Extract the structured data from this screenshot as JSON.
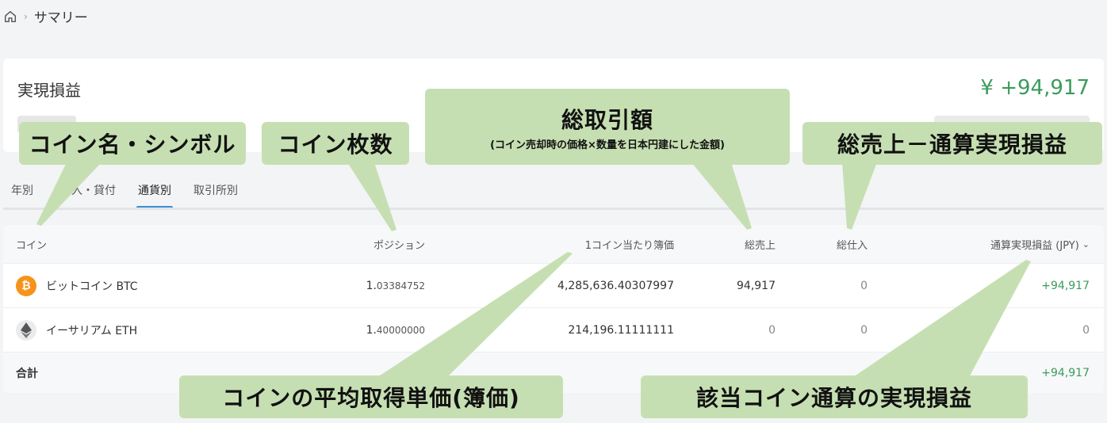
{
  "breadcrumb": {
    "current": "サマリー"
  },
  "summary": {
    "title": "実現損益",
    "value": "¥ +94,917"
  },
  "tabs": [
    {
      "label": "年別",
      "active": false
    },
    {
      "label": "入・貸付",
      "active": false
    },
    {
      "label": "通貨別",
      "active": true
    },
    {
      "label": "取引所別",
      "active": false
    }
  ],
  "table": {
    "headers": {
      "coin": "コイン",
      "position": "ポジション",
      "unit_price": "1コイン当たり簿価",
      "total_sales": "総売上",
      "total_purchase": "総仕入",
      "pnl": "通算実現損益 (JPY)"
    },
    "rows": [
      {
        "name": "ビットコイン BTC",
        "pos_main": "1.",
        "pos_dec": "03384752",
        "unit_price": "4,285,636.40307997",
        "sales": "94,917",
        "purchase": "0",
        "pnl": "+94,917"
      },
      {
        "name": "イーサリアム ETH",
        "pos_main": "1.",
        "pos_dec": "40000000",
        "unit_price": "214,196.11111111",
        "sales": "0",
        "purchase": "0",
        "pnl": "0"
      }
    ],
    "total": {
      "label": "合計",
      "pnl": "+94,917"
    }
  },
  "annotations": {
    "coin_name": "コイン名・シンボル",
    "coin_count": "コイン枚数",
    "total_trade": "総取引額",
    "total_trade_sub": "(コイン売却時の価格×数量を日本円建にした金額)",
    "sales_minus": "総売上－通算実現損益",
    "avg_price": "コインの平均取得単価(簿価)",
    "coin_pnl": "該当コイン通算の実現損益"
  },
  "colors": {
    "accent": "#3b8fd6",
    "positive": "#3b9b5b",
    "callout": "#c6dfb2",
    "btc": "#f7931a"
  }
}
